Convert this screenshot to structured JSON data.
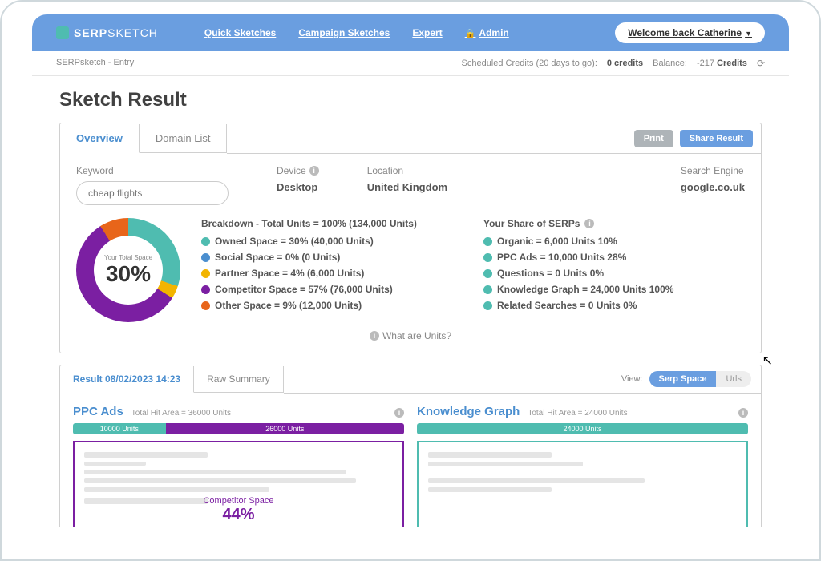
{
  "brand": {
    "name1": "SERP",
    "name2": "SKETCH"
  },
  "nav": {
    "quick": "Quick Sketches",
    "campaign": "Campaign Sketches",
    "expert": "Expert",
    "admin": "Admin"
  },
  "welcome": "Welcome back Catherine",
  "subbar": {
    "left": "SERPsketch - Entry",
    "sched_label": "Scheduled Credits (20 days to go):",
    "sched_val": "0 credits",
    "bal_label": "Balance:",
    "bal_val": "-217",
    "bal_unit": "Credits"
  },
  "page_title": "Sketch Result",
  "tabs": {
    "overview": "Overview",
    "domain": "Domain List"
  },
  "actions": {
    "print": "Print",
    "share": "Share Result"
  },
  "fields": {
    "keyword_label": "Keyword",
    "keyword_value": "cheap flights",
    "device_label": "Device",
    "device_value": "Desktop",
    "location_label": "Location",
    "location_value": "United Kingdom",
    "engine_label": "Search Engine",
    "engine_value": "google.co.uk"
  },
  "donut": {
    "label": "Your Total Space",
    "pct": "30%"
  },
  "breakdown": {
    "title": "Breakdown - Total Units = 100% (134,000 Units)",
    "items": [
      "Owned Space = 30% (40,000 Units)",
      "Social Space = 0% (0 Units)",
      "Partner Space = 4% (6,000 Units)",
      "Competitor Space = 57% (76,000 Units)",
      "Other Space = 9% (12,000 Units)"
    ]
  },
  "share": {
    "title": "Your Share of SERPs",
    "items": [
      "Organic = 6,000 Units 10%",
      "PPC Ads = 10,000 Units 28%",
      "Questions = 0 Units 0%",
      "Knowledge Graph = 24,000 Units 100%",
      "Related Searches = 0 Units 0%"
    ]
  },
  "units_link": "What are Units?",
  "result_tabs": {
    "result": "Result 08/02/2023 14:23",
    "raw": "Raw Summary"
  },
  "view": {
    "label": "View:",
    "serp": "Serp Space",
    "urls": "Urls"
  },
  "ppc": {
    "title": "PPC Ads",
    "sub": "Total Hit Area = 36000 Units",
    "seg1": "10000 Units",
    "seg2": "26000 Units",
    "space_label": "Competitor Space",
    "space_pct": "44%"
  },
  "kg": {
    "title": "Knowledge Graph",
    "sub": "Total Hit Area = 24000 Units",
    "seg": "24000 Units"
  },
  "chart_data": {
    "type": "pie",
    "title": "Your Total Space 30%",
    "series": [
      {
        "name": "Owned Space",
        "value": 30,
        "units": 40000,
        "color": "#4fbcb0"
      },
      {
        "name": "Social Space",
        "value": 0,
        "units": 0,
        "color": "#4a8ecf"
      },
      {
        "name": "Partner Space",
        "value": 4,
        "units": 6000,
        "color": "#f2b400"
      },
      {
        "name": "Competitor Space",
        "value": 57,
        "units": 76000,
        "color": "#7b1fa2"
      },
      {
        "name": "Other Space",
        "value": 9,
        "units": 12000,
        "color": "#e8651a"
      }
    ],
    "total_units": 134000
  }
}
